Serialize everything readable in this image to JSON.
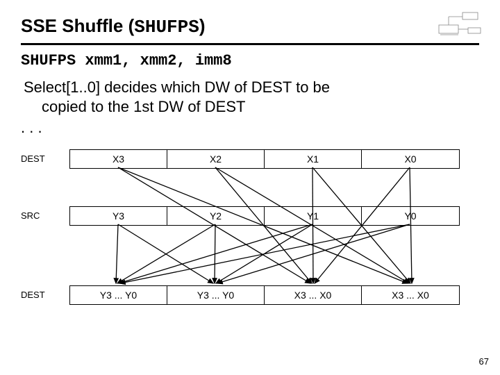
{
  "title_prefix": "SSE Shuffle (",
  "title_mnemonic": "SHUFPS",
  "title_suffix": ")",
  "syntax": "SHUFPS xmm1, xmm2, imm8",
  "description_line1": "Select[1..0] decides which DW of DEST to be",
  "description_line2": "copied to the 1st DW of DEST",
  "dots": ". . .",
  "labels": {
    "dest": "DEST",
    "src": "SRC",
    "destout": "DEST"
  },
  "dest_cells": [
    "X3",
    "X2",
    "X1",
    "X0"
  ],
  "src_cells": [
    "Y3",
    "Y2",
    "Y1",
    "Y0"
  ],
  "out_cells": [
    "Y3 ... Y0",
    "Y3 ... Y0",
    "X3 ... X0",
    "X3 ... X0"
  ],
  "page": "67"
}
